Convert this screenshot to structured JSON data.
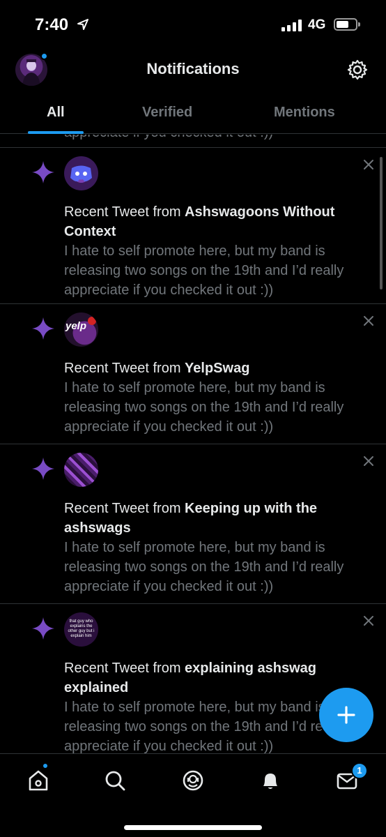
{
  "status_bar": {
    "time": "7:40",
    "network": "4G"
  },
  "header": {
    "title": "Notifications"
  },
  "tabs": [
    {
      "label": "All",
      "active": true
    },
    {
      "label": "Verified",
      "active": false
    },
    {
      "label": "Mentions",
      "active": false
    }
  ],
  "feed": {
    "partial_text": "appreciate if you checked it out :))",
    "items": [
      {
        "prefix": "Recent Tweet from ",
        "account": "Ashswagoons Without Context",
        "text": "I hate to self promote here, but my band is releasing two songs on the 19th and I’d really appreciate if you checked it out :))"
      },
      {
        "prefix": "Recent Tweet from ",
        "account": "YelpSwag",
        "avatar_text": "yelp",
        "text": "I hate to self promote here, but my band is releasing two songs on the 19th and I’d really appreciate if you checked it out :))"
      },
      {
        "prefix": "Recent Tweet from ",
        "account": "Keeping up with the ashswags",
        "text": "I hate to self promote here, but my band is releasing two songs on the 19th and I’d really appreciate if you checked it out :))"
      },
      {
        "prefix": "Recent Tweet from ",
        "account": "explaining ashswag explained",
        "avatar_text": "that guy who explains the other guy but i explain him",
        "text": "I hate to self promote here, but my band is releasing two songs on the 19th and I’d really appreciate if you checked it out :))"
      }
    ]
  },
  "fab": {
    "icon": "plus-icon"
  },
  "bottom_nav": {
    "items": [
      "home-icon",
      "search-icon",
      "spaces-icon",
      "bell-icon",
      "mail-icon"
    ],
    "messages_badge": "1"
  },
  "colors": {
    "accent": "#1d9bf0",
    "sparkle": "#794bc4",
    "secondary_text": "#71767b",
    "background": "#000000"
  }
}
